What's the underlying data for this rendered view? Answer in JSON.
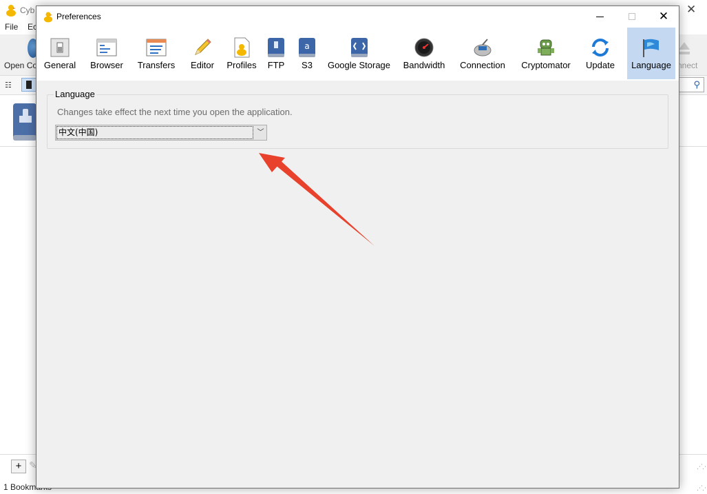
{
  "background_window": {
    "title": "Cyb",
    "menu": [
      "File",
      "Ec"
    ],
    "toolbar": {
      "open_connection_label": "Open Co",
      "disconnect_label": "nnect"
    },
    "status": "1 Bookmarks"
  },
  "dialog": {
    "title": "Preferences",
    "toolbar": [
      {
        "label": "General",
        "icon": "general-icon"
      },
      {
        "label": "Browser",
        "icon": "browser-icon"
      },
      {
        "label": "Transfers",
        "icon": "transfers-icon"
      },
      {
        "label": "Editor",
        "icon": "pencil-icon"
      },
      {
        "label": "Profiles",
        "icon": "profiles-icon"
      },
      {
        "label": "FTP",
        "icon": "ftp-icon"
      },
      {
        "label": "S3",
        "icon": "s3-icon"
      },
      {
        "label": "Google Storage",
        "icon": "google-storage-icon"
      },
      {
        "label": "Bandwidth",
        "icon": "bandwidth-icon"
      },
      {
        "label": "Connection",
        "icon": "connection-icon"
      },
      {
        "label": "Cryptomator",
        "icon": "cryptomator-icon"
      },
      {
        "label": "Update",
        "icon": "update-icon"
      },
      {
        "label": "Language",
        "icon": "flag-icon",
        "active": true
      }
    ],
    "language_section": {
      "legend": "Language",
      "hint": "Changes take effect the next time you open the application.",
      "selected_language": "中文(中国)"
    }
  },
  "colors": {
    "accent": "#c5d8f2",
    "annotation_arrow": "#e8412c"
  }
}
